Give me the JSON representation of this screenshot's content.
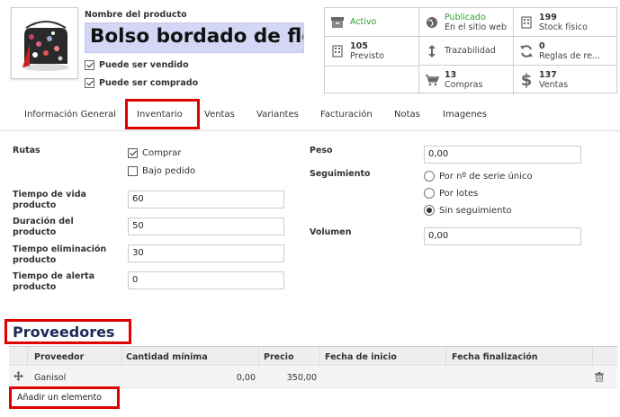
{
  "product": {
    "name_label": "Nombre del producto",
    "name": "Bolso bordado de flores",
    "checkboxes": [
      {
        "label": "Puede ser vendido",
        "checked": true
      },
      {
        "label": "Puede ser comprado",
        "checked": true
      }
    ]
  },
  "stats": [
    {
      "icon": "archive-icon",
      "line1": "Activo",
      "line2": "",
      "status_color": "#2aa12a"
    },
    {
      "icon": "globe-icon",
      "line1": "Publicado",
      "line2": "En el sitio web"
    },
    {
      "icon": "building-icon",
      "line1": "199",
      "line2": "Stock físico"
    },
    {
      "icon": "building-icon",
      "line1": "105",
      "line2": "Previsto"
    },
    {
      "icon": "arrows-vertical-icon",
      "line1": "Trazabilidad",
      "line2": ""
    },
    {
      "icon": "refresh-icon",
      "line1": "0",
      "line2": "Reglas de re..."
    },
    {
      "icon": "cart-icon",
      "line1": "13",
      "line2": "Compras"
    },
    {
      "icon": "dollar-icon",
      "line1": "137",
      "line2": "Ventas"
    }
  ],
  "tabs": [
    {
      "label": "Información General"
    },
    {
      "label": "Inventario",
      "active": true
    },
    {
      "label": "Ventas"
    },
    {
      "label": "Variantes"
    },
    {
      "label": "Facturación"
    },
    {
      "label": "Notas"
    },
    {
      "label": "Imagenes"
    }
  ],
  "inventory": {
    "routes_label": "Rutas",
    "routes": [
      {
        "label": "Comprar",
        "checked": true
      },
      {
        "label": "Bajo pedido",
        "checked": false
      }
    ],
    "fields": [
      {
        "label_line1": "Tiempo de vida",
        "label_line2": "producto",
        "value": "60"
      },
      {
        "label_line1": "Duración del",
        "label_line2": "producto",
        "value": "50"
      },
      {
        "label_line1": "Tiempo eliminación",
        "label_line2": "producto",
        "value": "30"
      },
      {
        "label_line1": "Tiempo de alerta",
        "label_line2": "producto",
        "value": "0"
      }
    ],
    "weight_label": "Peso",
    "weight_value": "0,00",
    "tracking_label": "Seguimiento",
    "tracking_options": [
      {
        "label": "Por nº de serie único",
        "selected": false
      },
      {
        "label": "Por lotes",
        "selected": false
      },
      {
        "label": "Sin seguimiento",
        "selected": true
      }
    ],
    "volume_label": "Volumen",
    "volume_value": "0,00"
  },
  "suppliers": {
    "title": "Proveedores",
    "columns": [
      "Proveedor",
      "Cantidad mínima",
      "Precio",
      "Fecha de inicio",
      "Fecha finalización"
    ],
    "rows": [
      {
        "supplier": "Ganisol",
        "min_qty": "0,00",
        "price": "350,00",
        "start": "",
        "end": ""
      }
    ],
    "add_label": "Añadir un elemento"
  },
  "colors": {
    "highlight": "#e00000",
    "name_bg": "#d3d6f5",
    "section_title": "#1a2b57"
  }
}
